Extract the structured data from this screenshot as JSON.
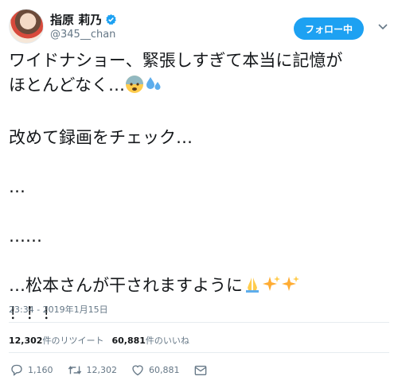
{
  "user": {
    "display_name": "指原 莉乃",
    "handle": "@345__chan",
    "verified": true
  },
  "follow_button": {
    "label": "フォロー中"
  },
  "tweet": {
    "lines": [
      "ワイドナショー、緊張しすぎて本当に記憶が",
      "ほとんどなく…",
      "",
      "改めて録画をチェック…",
      "",
      "…",
      "",
      "……",
      "",
      "…松本さんが干されますように",
      "！！！"
    ],
    "emojis": [
      "anxious-face-emoji",
      "sweat-droplets-emoji",
      "folded-hands-emoji",
      "sparkles-emoji",
      "sparkles-emoji"
    ],
    "timestamp": "23:34 - 2019年1月15日"
  },
  "stats": {
    "retweets_count": "12,302",
    "retweets_label": "件のリツイート",
    "likes_count": "60,881",
    "likes_label": "件のいいね"
  },
  "actions": {
    "reply_count": "1,160",
    "retweet_count": "12,302",
    "like_count": "60,881"
  },
  "colors": {
    "accent": "#1da1f2",
    "text": "#14171a",
    "muted": "#657786",
    "divider": "#e6ecf0"
  }
}
